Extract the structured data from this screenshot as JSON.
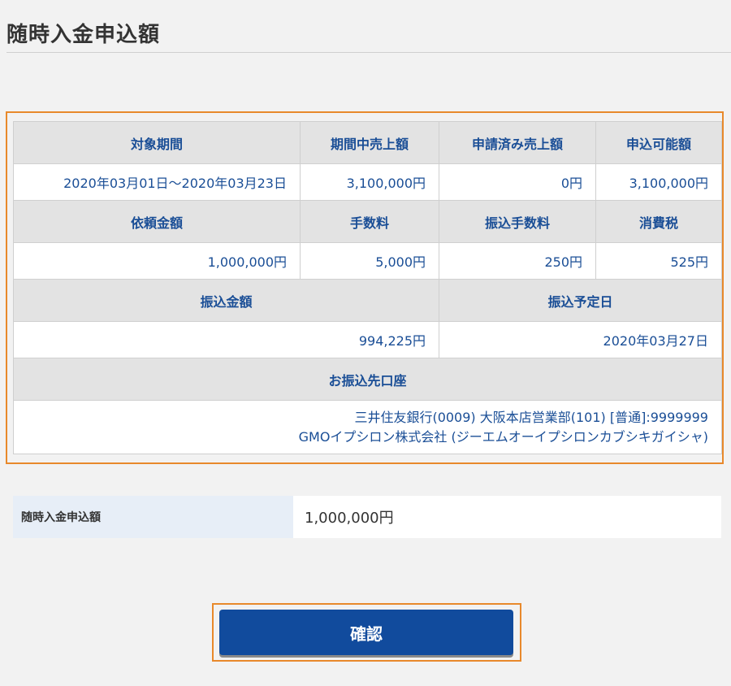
{
  "page": {
    "title": "随時入金申込額"
  },
  "summary": {
    "headers1": [
      "対象期間",
      "期間中売上額",
      "申請済み売上額",
      "申込可能額"
    ],
    "values1": [
      "2020年03月01日～2020年03月23日",
      "3,100,000円",
      "0円",
      "3,100,000円"
    ],
    "headers2": [
      "依頼金額",
      "手数料",
      "振込手数料",
      "消費税"
    ],
    "values2": [
      "1,000,000円",
      "5,000円",
      "250円",
      "525円"
    ],
    "headers3": [
      "振込金額",
      "振込予定日"
    ],
    "values3": [
      "994,225円",
      "2020年03月27日"
    ],
    "account_header": "お振込先口座",
    "account_line1": "三井住友銀行(0009) 大阪本店営業部(101) [普通]:9999999",
    "account_line2": "GMOイプシロン株式会社 (ジーエムオーイプシロンカブシキガイシャ)"
  },
  "input": {
    "label": "随時入金申込額",
    "value": "1,000,000円"
  },
  "actions": {
    "confirm_label": "確認"
  },
  "colors": {
    "accent": "#114b9d",
    "highlight": "#e8892b",
    "header_bg": "#e3e3e3",
    "link_text": "#1a4e96"
  }
}
